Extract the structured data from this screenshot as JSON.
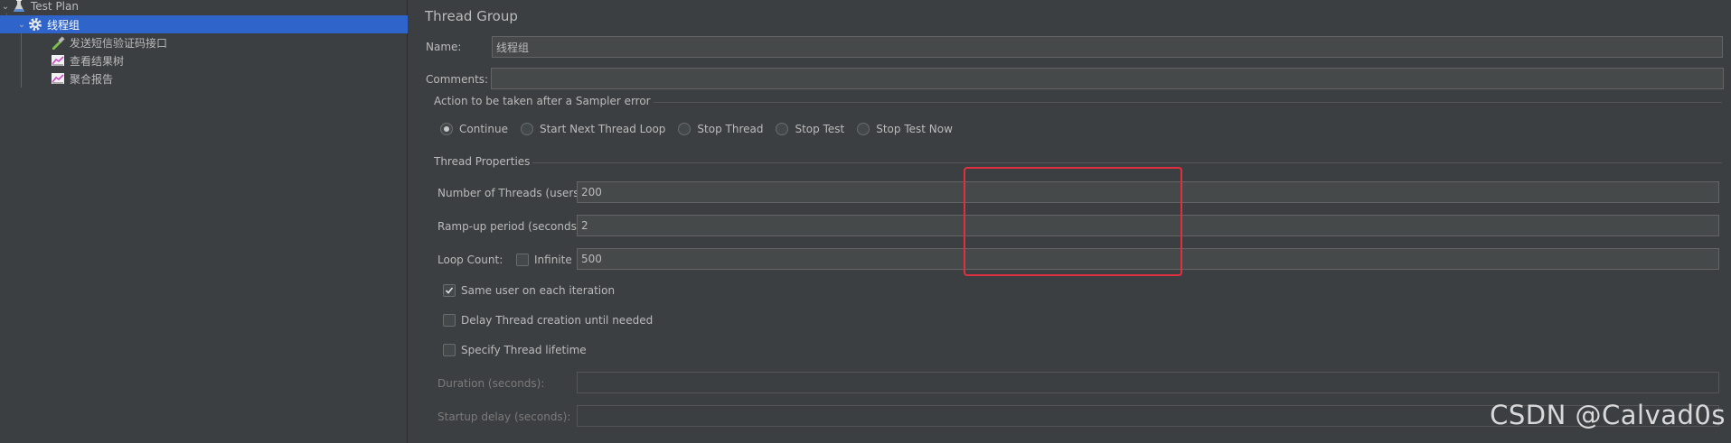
{
  "tree": {
    "items": [
      {
        "label": "Test Plan",
        "icon": "flask-icon"
      },
      {
        "label": "线程组",
        "icon": "gear-icon"
      },
      {
        "label": "发送短信验证码接口",
        "icon": "pipette-icon"
      },
      {
        "label": "查看结果树",
        "icon": "graph-icon"
      },
      {
        "label": "聚合报告",
        "icon": "graph-icon"
      }
    ]
  },
  "panel": {
    "title": "Thread Group",
    "name_label": "Name:",
    "name_value": "线程组",
    "comments_label": "Comments:",
    "comments_value": "",
    "sampler_error": {
      "legend": "Action to be taken after a Sampler error",
      "options": [
        "Continue",
        "Start Next Thread Loop",
        "Stop Thread",
        "Stop Test",
        "Stop Test Now"
      ],
      "selected": "Continue"
    },
    "thread_props": {
      "legend": "Thread Properties",
      "threads_label": "Number of Threads (users):",
      "threads_value": "200",
      "rampup_label": "Ramp-up period (seconds):",
      "rampup_value": "2",
      "loop_label": "Loop Count:",
      "infinite_label": "Infinite",
      "infinite_checked": false,
      "loop_value": "500",
      "same_user_label": "Same user on each iteration",
      "same_user_checked": true,
      "delay_label": "Delay Thread creation until needed",
      "delay_checked": false,
      "lifetime_label": "Specify Thread lifetime",
      "lifetime_checked": false,
      "duration_label": "Duration (seconds):",
      "duration_value": "",
      "startup_label": "Startup delay (seconds):",
      "startup_value": ""
    }
  },
  "watermark": "CSDN @Calvad0s",
  "colors": {
    "selection": "#2f65ca",
    "highlight": "#e0303f",
    "background": "#3c3f41"
  }
}
